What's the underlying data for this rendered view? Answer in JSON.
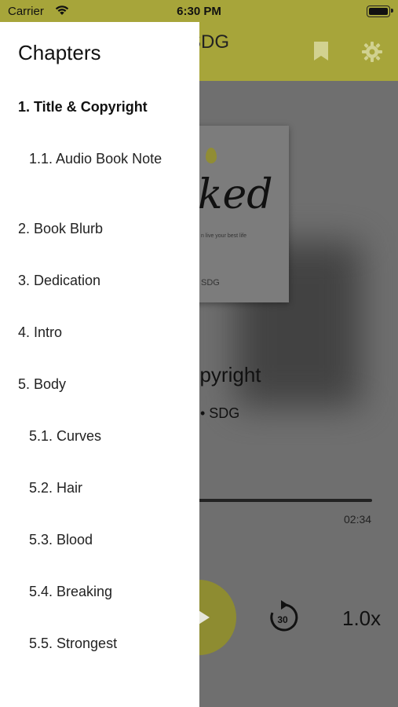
{
  "status": {
    "carrier": "Carrier",
    "time": "6:30 PM"
  },
  "appbar": {
    "title_fragment": "SDG"
  },
  "cover": {
    "word_fragment": "ked",
    "tag_fragment": "n live your best life",
    "author": "SDG"
  },
  "player": {
    "track_title_fragment": "opyright",
    "track_subtitle_fragment": "• SDG",
    "duration": "02:34",
    "skip_seconds": "30",
    "speed": "1.0x"
  },
  "drawer": {
    "heading": "Chapters",
    "chapters": [
      {
        "label": "1. Title & Copyright",
        "level": 1,
        "active": true
      },
      {
        "label": "1.1. Audio Book Note",
        "level": 2,
        "active": false
      },
      {
        "label": "2. Book Blurb",
        "level": 1,
        "active": false
      },
      {
        "label": "3. Dedication",
        "level": 1,
        "active": false
      },
      {
        "label": "4. Intro",
        "level": 1,
        "active": false
      },
      {
        "label": "5. Body",
        "level": 1,
        "active": false
      },
      {
        "label": "5.1. Curves",
        "level": 2,
        "active": false
      },
      {
        "label": "5.2. Hair",
        "level": 2,
        "active": false
      },
      {
        "label": "5.3. Blood",
        "level": 2,
        "active": false
      },
      {
        "label": "5.4. Breaking",
        "level": 2,
        "active": false
      },
      {
        "label": "5.5. Strongest",
        "level": 2,
        "active": false
      }
    ]
  },
  "icons": [
    "wifi-icon",
    "battery-icon",
    "bookmark-icon",
    "gear-icon",
    "play-icon",
    "forward-30-icon"
  ],
  "colors": {
    "accent": "#a7a53a",
    "drawer_bg": "#ffffff",
    "scrim": "#7a7a7a"
  }
}
